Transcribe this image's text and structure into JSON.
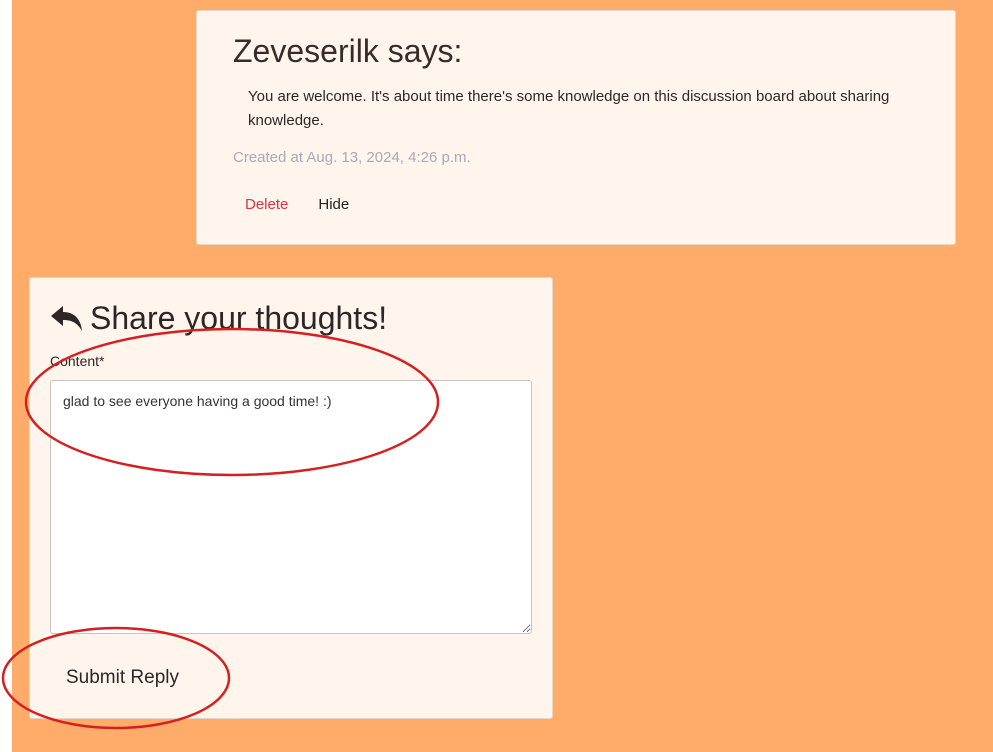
{
  "comment": {
    "author_line": "Zeveserilk says:",
    "body": "You are welcome. It's about time there's some knowledge on this discussion board about sharing knowledge.",
    "created": "Created at Aug. 13, 2024, 4:26 p.m.",
    "delete_label": "Delete",
    "hide_label": "Hide"
  },
  "reply_form": {
    "icon": "reply-arrow-icon",
    "heading": "Share your thoughts!",
    "content_label": "Content*",
    "content_value": "glad to see everyone having a good time! :)",
    "submit_label": "Submit Reply"
  },
  "colors": {
    "page_background": "#ffac6b",
    "card_background": "#fff5ec",
    "delete_red": "#d9343f",
    "annotation_red": "#d42020",
    "meta_gray": "#a9a9b8"
  }
}
